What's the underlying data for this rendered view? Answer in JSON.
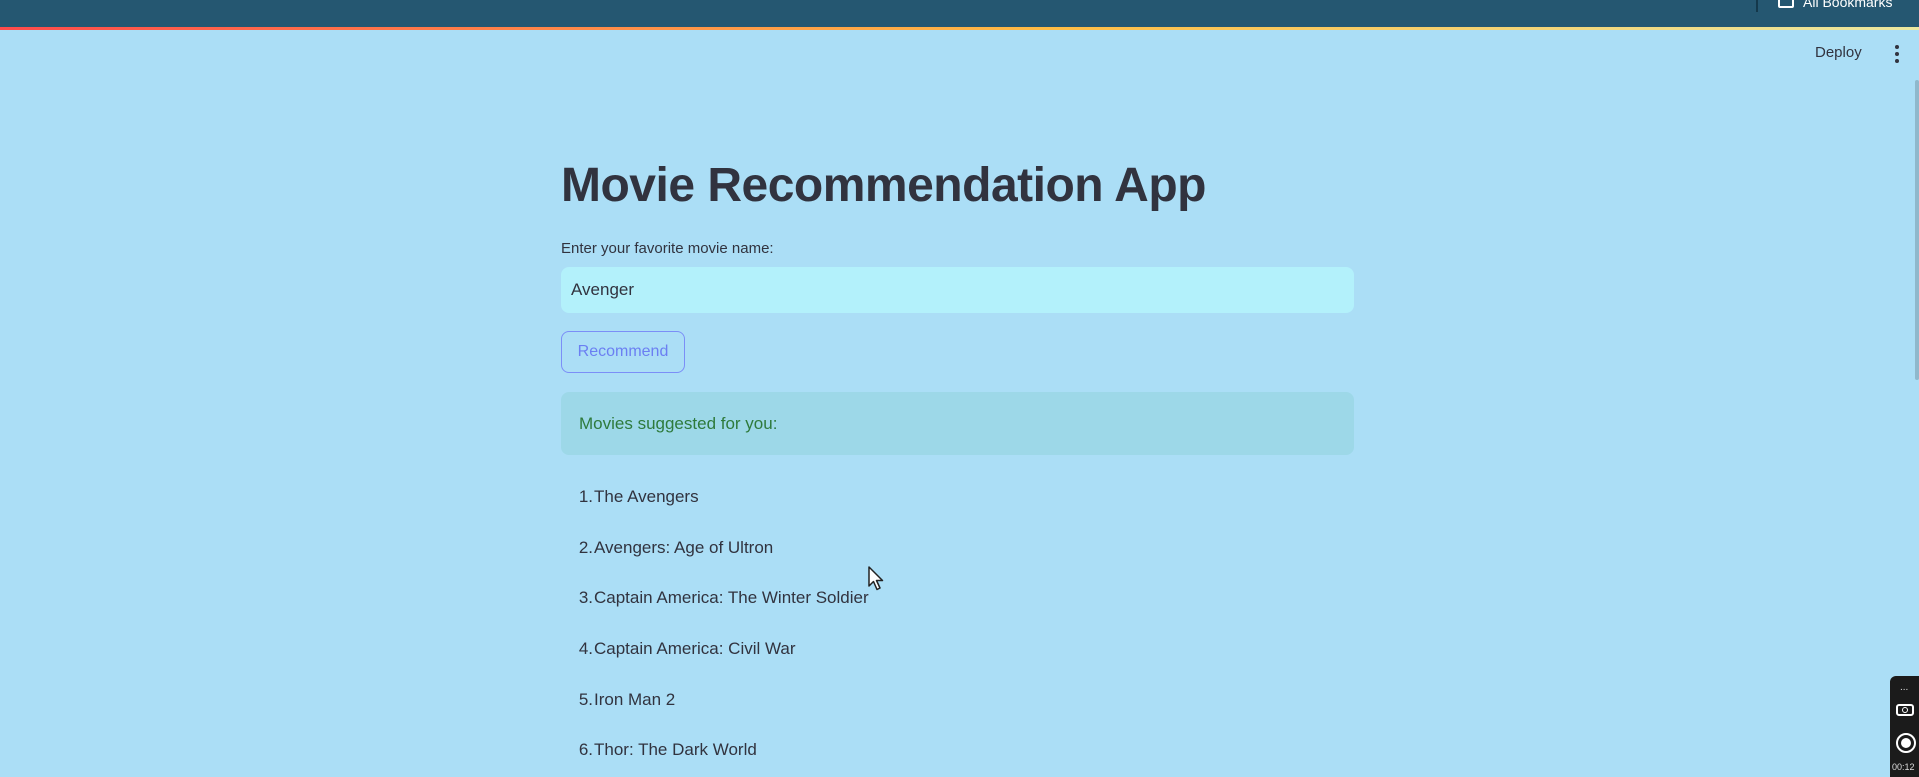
{
  "browser": {
    "bookmarks_label": "All Bookmarks"
  },
  "header": {
    "deploy_label": "Deploy",
    "menu_icon": "kebab-menu-icon"
  },
  "app": {
    "title": "Movie Recommendation App",
    "input_label": "Enter your favorite movie name:",
    "input_value": "Avenger",
    "button_label": "Recommend",
    "success_message": "Movies suggested for you:",
    "recommendations": [
      {
        "num": "1.",
        "title": "The Avengers"
      },
      {
        "num": "2.",
        "title": "Avengers: Age of Ultron"
      },
      {
        "num": "3.",
        "title": "Captain America: The Winter Soldier"
      },
      {
        "num": "4.",
        "title": "Captain America: Civil War"
      },
      {
        "num": "5.",
        "title": "Iron Man 2"
      },
      {
        "num": "6.",
        "title": "Thor: The Dark World"
      }
    ]
  },
  "recorder": {
    "menu_label": "...",
    "time": "00:12"
  },
  "colors": {
    "page_background": "#abdef6",
    "browser_bar": "#255771",
    "input_background": "#b3f1fb",
    "success_background": "#9dd8e8",
    "success_text": "#2e7a3c",
    "button_accent": "#7b8ef7"
  }
}
